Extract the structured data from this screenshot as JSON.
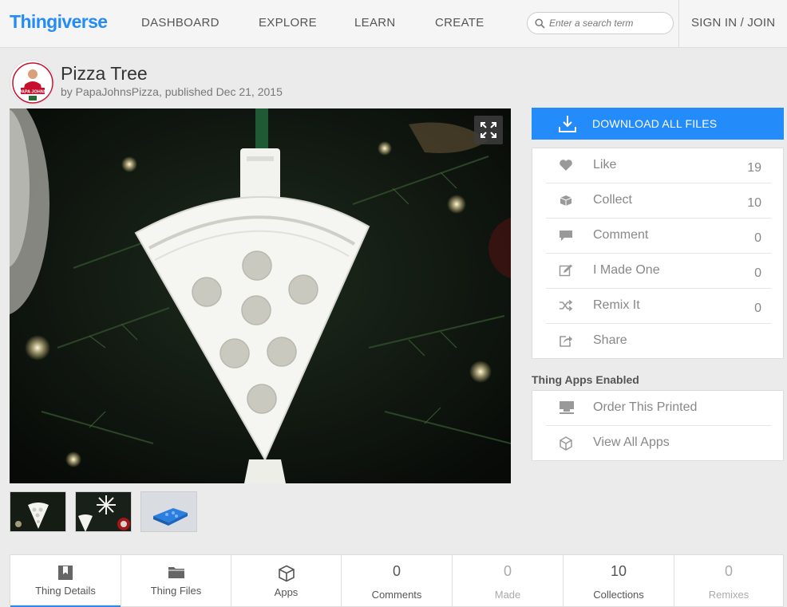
{
  "header": {
    "logo": "Thingiverse",
    "nav": [
      "DASHBOARD",
      "EXPLORE",
      "LEARN",
      "CREATE"
    ],
    "search_placeholder": "Enter a search term",
    "signin": "SIGN IN / JOIN"
  },
  "thing": {
    "title": "Pizza Tree",
    "byline": "by PapaJohnsPizza, published Dec 21, 2015",
    "avatar_brand": "PAPA JOHNS"
  },
  "download_label": "DOWNLOAD ALL FILES",
  "actions": [
    {
      "label": "Like",
      "count": "19",
      "icon": "heart-icon"
    },
    {
      "label": "Collect",
      "count": "10",
      "icon": "collect-icon"
    },
    {
      "label": "Comment",
      "count": "0",
      "icon": "comment-icon"
    },
    {
      "label": "I Made One",
      "count": "0",
      "icon": "made-icon"
    },
    {
      "label": "Remix It",
      "count": "0",
      "icon": "remix-icon"
    },
    {
      "label": "Share",
      "count": "",
      "icon": "share-icon"
    }
  ],
  "apps": {
    "title": "Thing Apps Enabled",
    "items": [
      {
        "label": "Order This Printed",
        "icon": "printer-icon"
      },
      {
        "label": "View All Apps",
        "icon": "cube-icon"
      }
    ]
  },
  "tabs": [
    {
      "label": "Thing Details",
      "icon": "details-icon"
    },
    {
      "label": "Thing Files",
      "icon": "folder-icon"
    },
    {
      "label": "Apps",
      "icon": "cube-icon"
    },
    {
      "count": "0",
      "label": "Comments"
    },
    {
      "count": "0",
      "label": "Made"
    },
    {
      "count": "10",
      "label": "Collections"
    },
    {
      "count": "0",
      "label": "Remixes"
    }
  ],
  "colors": {
    "accent": "#248bfb",
    "background": "#ebebeb"
  }
}
